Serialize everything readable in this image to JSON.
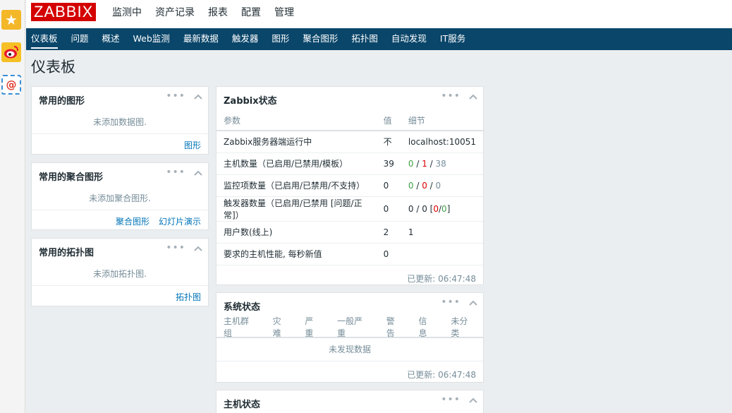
{
  "logo": "ZABBIX",
  "top_menu": [
    "监测中",
    "资产记录",
    "报表",
    "配置",
    "管理"
  ],
  "sub_nav": [
    "仪表板",
    "问题",
    "概述",
    "Web监测",
    "最新数据",
    "触发器",
    "图形",
    "聚合图形",
    "拓扑图",
    "自动发现",
    "IT服务"
  ],
  "page_title": "仪表板",
  "favorite_graphs": {
    "title": "常用的图形",
    "empty": "未添加数据图.",
    "links": [
      "图形"
    ]
  },
  "favorite_screens": {
    "title": "常用的聚合图形",
    "empty": "未添加聚合图形.",
    "links": [
      "聚合图形",
      "幻灯片演示"
    ]
  },
  "favorite_maps": {
    "title": "常用的拓扑图",
    "empty": "未添加拓扑图.",
    "links": [
      "拓扑图"
    ]
  },
  "zabbix_status": {
    "title": "Zabbix状态",
    "headers": [
      "参数",
      "值",
      "细节"
    ],
    "rows": [
      {
        "param": "Zabbix服务器端运行中",
        "value": "不",
        "details": "localhost:10051"
      },
      {
        "param": "主机数量（已启用/已禁用/模板）",
        "value": "39",
        "d1": "0",
        "d2": "1",
        "d3": "38"
      },
      {
        "param": "监控项数量（已启用/已禁用/不支持）",
        "value": "0",
        "d1": "0",
        "d2": "0",
        "d3": "0"
      },
      {
        "param": "触发器数量（已启用/已禁用 [问题/正常]）",
        "value": "0",
        "d1": "0",
        "d2": "0",
        "d3": "0",
        "d4": "0"
      },
      {
        "param": "用户数(线上)",
        "value": "2",
        "details": "1"
      },
      {
        "param": "要求的主机性能, 每秒新值",
        "value": "0",
        "details": ""
      }
    ],
    "updated": "已更新: 06:47:48"
  },
  "system_status": {
    "title": "系统状态",
    "headers": [
      "主机群组",
      "灾难",
      "严重",
      "一般严重",
      "警告",
      "信息",
      "未分类"
    ],
    "empty": "未发现数据",
    "updated": "已更新: 06:47:48"
  },
  "host_status": {
    "title": "主机状态"
  },
  "colors": {
    "nav_bg": "#0a466a",
    "logo_bg": "#d40000",
    "link": "#0275b8",
    "green": "#429e47",
    "red": "#dc0000"
  }
}
